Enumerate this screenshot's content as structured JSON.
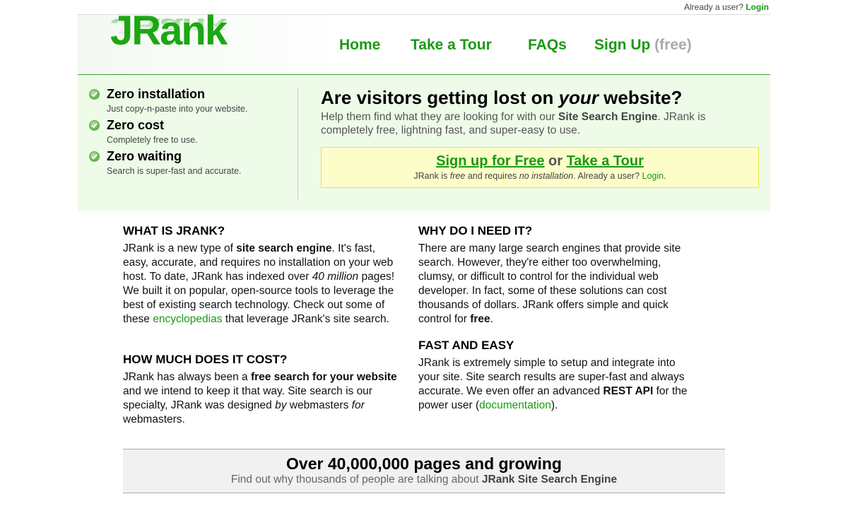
{
  "top_bar": {
    "already_user": "Already a user?",
    "login": "Login"
  },
  "logo": {
    "text": "JRank"
  },
  "nav": [
    {
      "label": "Home"
    },
    {
      "label": "Take a Tour"
    },
    {
      "label": "FAQs"
    },
    {
      "label": "Sign Up",
      "suffix": "(free)"
    }
  ],
  "features": [
    {
      "title": "Zero installation",
      "subtitle": "Just copy-n-paste into your website."
    },
    {
      "title": "Zero cost",
      "subtitle": "Completely free to use."
    },
    {
      "title": "Zero waiting",
      "subtitle": "Search is super-fast and accurate."
    }
  ],
  "hero": {
    "headline_pre": "Are visitors getting lost on ",
    "headline_em": "your",
    "headline_post": " website?",
    "sub_pre": "Help them find what they are looking for with our ",
    "sub_bold": "Site Search Engine",
    "sub_post": ". JRank is completely free, lightning fast, and super-easy to use."
  },
  "cta": {
    "signup": "Sign up for Free",
    "or": "or",
    "tour": "Take a Tour",
    "note_1": "JRank is ",
    "note_free": "free",
    "note_2": " and requires ",
    "note_noinst": "no installation",
    "note_3": ". Already a user? ",
    "login": "Login",
    "note_4": "."
  },
  "sections": {
    "what": {
      "title": "WHAT IS JRANK?",
      "t1": "JRank is a new type of ",
      "b1": "site search engine",
      "t2": ". It's fast, easy, accurate, and requires no installation on your web host. To date, JRank has indexed over ",
      "i1": "40 million",
      "t3": " pages! We built it on popular, open-source tools to leverage the best of existing search technology. Check out some of these ",
      "link": "encyclopedias",
      "t4": " that leverage JRank's site search."
    },
    "cost": {
      "title": "HOW MUCH DOES IT COST?",
      "t1": "JRank has always been a ",
      "b1": "free search for your website",
      "t2": " and we intend to keep it that way. Site search is our specialty, JRank was designed ",
      "i1": "by",
      "t3": " webmasters ",
      "i2": "for",
      "t4": " webmasters."
    },
    "why": {
      "title": "WHY DO I NEED IT?",
      "t1": "There are many large search engines that provide site search. However, they're either too overwhelming, clumsy, or difficult to control for the individual web developer. In fact, some of these solutions can cost thousands of dollars. JRank offers simple and quick control for ",
      "b1": "free",
      "t2": "."
    },
    "fast": {
      "title": "FAST AND EASY",
      "t1": "JRank is extremely simple to setup and integrate into your site. Site search results are super-fast and always accurate. We even offer an advanced ",
      "b1": "REST API",
      "t2": " for the power user (",
      "link": "documentation",
      "t3": ")."
    }
  },
  "stats": {
    "headline": "Over 40,000,000 pages and growing",
    "sub_pre": "Find out why thousands of people are talking about ",
    "sub_bold": "JRank Site Search Engine"
  },
  "colors": {
    "brand_green": "#1a9a12",
    "hero_bg": "#eefbe9",
    "cta_bg": "#fdfdc9"
  },
  "icons": {
    "feature_bullet": "check-circle-icon"
  }
}
